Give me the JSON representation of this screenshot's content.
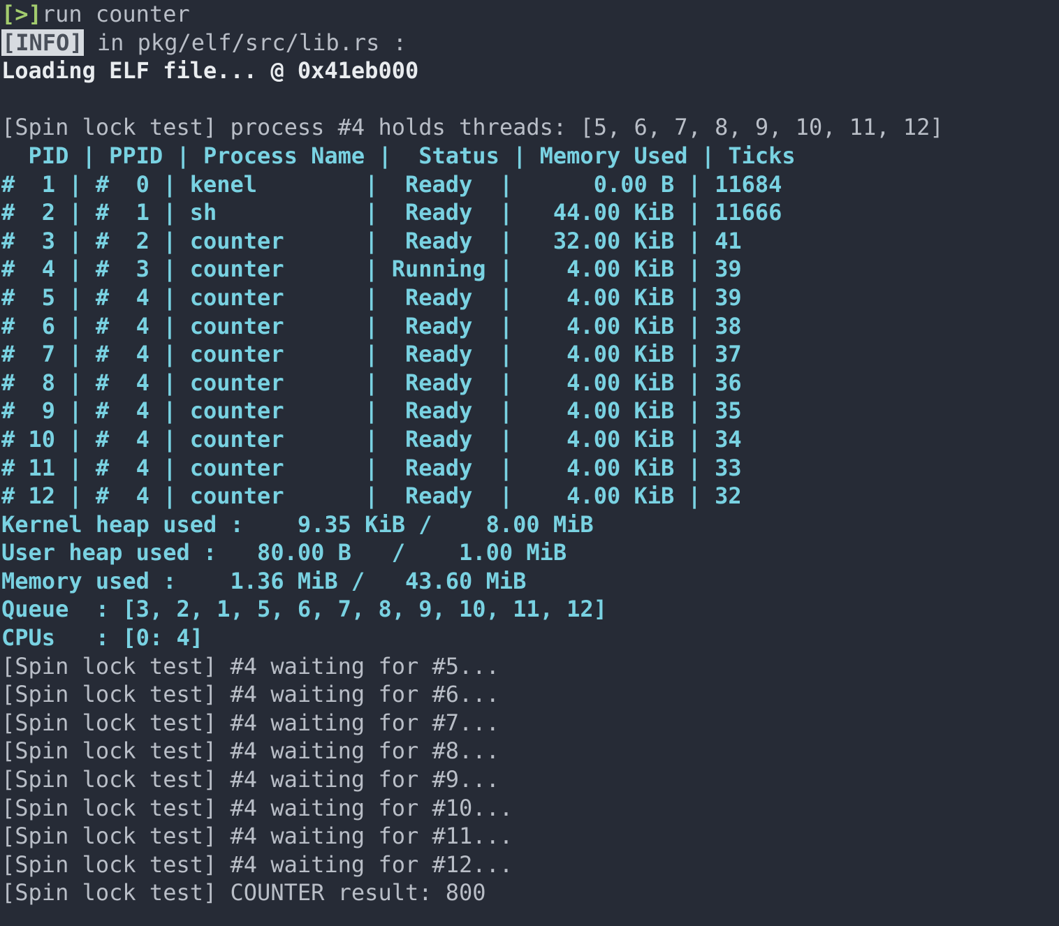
{
  "terminal": {
    "background_color": "#262b36",
    "prompt_color": "#a3cc6e",
    "dim_text_color": "#b9bec7",
    "bright_text_color": "#e9ecef",
    "accent_color": "#79d2e2",
    "badge_bg_color": "#d7dbe0",
    "badge_text_color": "#4a505a"
  },
  "prompt": {
    "marker": "[>]",
    "command": "run counter"
  },
  "log": {
    "level_badge": "[INFO]",
    "location_text": " in pkg/elf/src/lib.rs :",
    "message": "Loading ELF file... @ 0x41eb000"
  },
  "spin_lock_header": "[Spin lock test] process #4 holds threads: [5, 6, 7, 8, 9, 10, 11, 12]",
  "process_table": {
    "header": "  PID | PPID | Process Name |  Status | Memory Used | Ticks",
    "columns": [
      "PID",
      "PPID",
      "Process Name",
      "Status",
      "Memory Used",
      "Ticks"
    ],
    "rows": [
      "#  1 | #  0 | kenel        |  Ready  |      0.00 B | 11684",
      "#  2 | #  1 | sh           |  Ready  |   44.00 KiB | 11666",
      "#  3 | #  2 | counter      |  Ready  |   32.00 KiB | 41",
      "#  4 | #  3 | counter      | Running |    4.00 KiB | 39",
      "#  5 | #  4 | counter      |  Ready  |    4.00 KiB | 39",
      "#  6 | #  4 | counter      |  Ready  |    4.00 KiB | 38",
      "#  7 | #  4 | counter      |  Ready  |    4.00 KiB | 37",
      "#  8 | #  4 | counter      |  Ready  |    4.00 KiB | 36",
      "#  9 | #  4 | counter      |  Ready  |    4.00 KiB | 35",
      "# 10 | #  4 | counter      |  Ready  |    4.00 KiB | 34",
      "# 11 | #  4 | counter      |  Ready  |    4.00 KiB | 33",
      "# 12 | #  4 | counter      |  Ready  |    4.00 KiB | 32"
    ],
    "records": [
      {
        "pid": "#  1",
        "ppid": "#  0",
        "name": "kenel",
        "status": "Ready",
        "memory": "0.00 B",
        "ticks": "11684"
      },
      {
        "pid": "#  2",
        "ppid": "#  1",
        "name": "sh",
        "status": "Ready",
        "memory": "44.00 KiB",
        "ticks": "11666"
      },
      {
        "pid": "#  3",
        "ppid": "#  2",
        "name": "counter",
        "status": "Ready",
        "memory": "32.00 KiB",
        "ticks": "41"
      },
      {
        "pid": "#  4",
        "ppid": "#  3",
        "name": "counter",
        "status": "Running",
        "memory": "4.00 KiB",
        "ticks": "39"
      },
      {
        "pid": "#  5",
        "ppid": "#  4",
        "name": "counter",
        "status": "Ready",
        "memory": "4.00 KiB",
        "ticks": "39"
      },
      {
        "pid": "#  6",
        "ppid": "#  4",
        "name": "counter",
        "status": "Ready",
        "memory": "4.00 KiB",
        "ticks": "38"
      },
      {
        "pid": "#  7",
        "ppid": "#  4",
        "name": "counter",
        "status": "Ready",
        "memory": "4.00 KiB",
        "ticks": "37"
      },
      {
        "pid": "#  8",
        "ppid": "#  4",
        "name": "counter",
        "status": "Ready",
        "memory": "4.00 KiB",
        "ticks": "36"
      },
      {
        "pid": "#  9",
        "ppid": "#  4",
        "name": "counter",
        "status": "Ready",
        "memory": "4.00 KiB",
        "ticks": "35"
      },
      {
        "pid": "# 10",
        "ppid": "#  4",
        "name": "counter",
        "status": "Ready",
        "memory": "4.00 KiB",
        "ticks": "34"
      },
      {
        "pid": "# 11",
        "ppid": "#  4",
        "name": "counter",
        "status": "Ready",
        "memory": "4.00 KiB",
        "ticks": "33"
      },
      {
        "pid": "# 12",
        "ppid": "#  4",
        "name": "counter",
        "status": "Ready",
        "memory": "4.00 KiB",
        "ticks": "32"
      }
    ]
  },
  "summary": {
    "kernel_heap": "Kernel heap used :    9.35 KiB /    8.00 MiB",
    "user_heap": "User heap used :   80.00 B   /    1.00 MiB",
    "memory_used": "Memory used :    1.36 MiB /   43.60 MiB",
    "queue": "Queue  : [3, 2, 1, 5, 6, 7, 8, 9, 10, 11, 12]",
    "cpus": "CPUs   : [0: 4]",
    "values": {
      "kernel_heap_used": "9.35 KiB",
      "kernel_heap_total": "8.00 MiB",
      "user_heap_used": "80.00 B",
      "user_heap_total": "1.00 MiB",
      "memory_used": "1.36 MiB",
      "memory_total": "43.60 MiB",
      "queue_list": "[3, 2, 1, 5, 6, 7, 8, 9, 10, 11, 12]",
      "cpus_list": "[0: 4]"
    }
  },
  "spin_lock_output": [
    "[Spin lock test] #4 waiting for #5...",
    "[Spin lock test] #4 waiting for #6...",
    "[Spin lock test] #4 waiting for #7...",
    "[Spin lock test] #4 waiting for #8...",
    "[Spin lock test] #4 waiting for #9...",
    "[Spin lock test] #4 waiting for #10...",
    "[Spin lock test] #4 waiting for #11...",
    "[Spin lock test] #4 waiting for #12...",
    "[Spin lock test] COUNTER result: 800"
  ],
  "counter_result": "800"
}
